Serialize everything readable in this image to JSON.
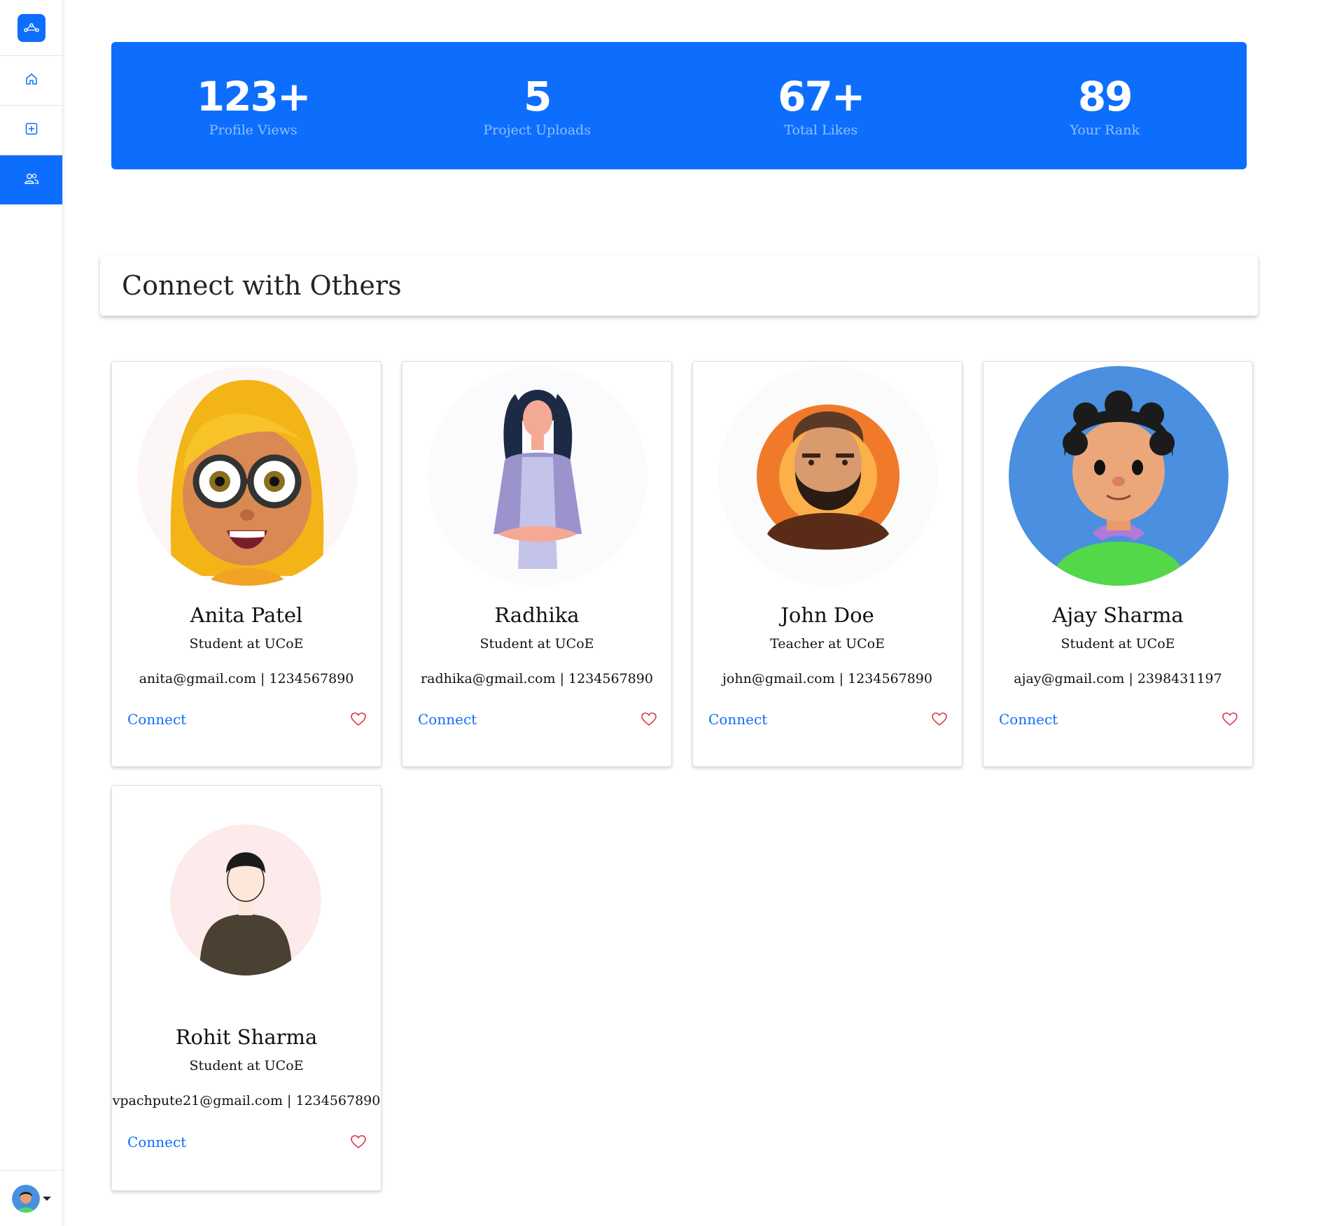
{
  "sidebar": {
    "brand_icon": "share-nodes-icon",
    "items": [
      {
        "name": "home",
        "icon": "home-icon",
        "active": false
      },
      {
        "name": "add-project",
        "icon": "plus-square-icon",
        "active": false
      },
      {
        "name": "connect",
        "icon": "people-icon",
        "active": true
      }
    ],
    "user_menu_icon": "caret-down-icon"
  },
  "stats": [
    {
      "value": "123+",
      "label": "Profile Views"
    },
    {
      "value": "5",
      "label": "Project Uploads"
    },
    {
      "value": "67+",
      "label": "Total Likes"
    },
    {
      "value": "89",
      "label": "Your Rank"
    }
  ],
  "section": {
    "title": "Connect with Others"
  },
  "cards": [
    {
      "name": "Anita Patel",
      "role": "Student at UCoE",
      "contact": "anita@gmail.com | 1234567890",
      "connect_label": "Connect"
    },
    {
      "name": "Radhika",
      "role": "Student at UCoE",
      "contact": "radhika@gmail.com | 1234567890",
      "connect_label": "Connect"
    },
    {
      "name": "John Doe",
      "role": "Teacher at UCoE",
      "contact": "john@gmail.com | 1234567890",
      "connect_label": "Connect"
    },
    {
      "name": "Ajay Sharma",
      "role": "Student at UCoE",
      "contact": "ajay@gmail.com | 2398431197",
      "connect_label": "Connect"
    },
    {
      "name": "Rohit Sharma",
      "role": "Student at UCoE",
      "contact": "vpachpute21@gmail.com | 1234567890",
      "connect_label": "Connect"
    }
  ],
  "colors": {
    "primary": "#0d6efd",
    "heart": "#dc3545"
  }
}
